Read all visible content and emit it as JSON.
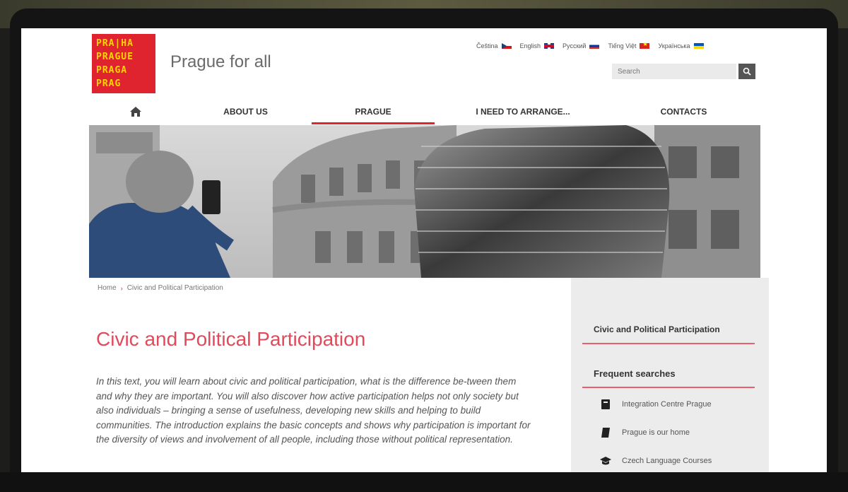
{
  "site": {
    "logo_lines": [
      "PRA|HA",
      "PRAGUE",
      "PRAGA",
      "PRAG"
    ],
    "title": "Prague for all"
  },
  "languages": [
    {
      "label": "Čeština",
      "flag": "cz-flag"
    },
    {
      "label": "English",
      "flag": "gb-flag"
    },
    {
      "label": "Русский",
      "flag": "ru-flag"
    },
    {
      "label": "Tiếng Việt",
      "flag": "vn-flag"
    },
    {
      "label": "Українська",
      "flag": "ua-flag"
    }
  ],
  "search": {
    "placeholder": "Search"
  },
  "nav": {
    "home_icon": "home-icon",
    "items": [
      "ABOUT US",
      "PRAGUE",
      "I NEED TO ARRANGE...",
      "CONTACTS"
    ],
    "active": "PRAGUE"
  },
  "breadcrumb": {
    "home": "Home",
    "separator": "›",
    "current": "Civic and Political Participation"
  },
  "main": {
    "title": "Civic and Political Participation",
    "intro": "In this text, you will learn about civic and political participation, what is the difference be-tween them and why they are important. You will also discover how active participation helps not only society but also individuals – bringing a sense of usefulness, developing new skills and helping to build communities. The introduction explains the basic concepts and shows why participation is important for the diversity of views and involvement of all people, including those without political representation."
  },
  "sidebar": {
    "current": "Civic and Political Participation",
    "frequent_heading": "Frequent searches",
    "links": [
      {
        "label": "Integration Centre Prague",
        "icon": "book-icon"
      },
      {
        "label": "Prague is our home",
        "icon": "book-icon"
      },
      {
        "label": "Czech Language Courses",
        "icon": "graduation-cap-icon"
      }
    ]
  },
  "colors": {
    "brand_red": "#e0242f",
    "logo_yellow": "#ffd400",
    "title_pink": "#e04a5a"
  }
}
